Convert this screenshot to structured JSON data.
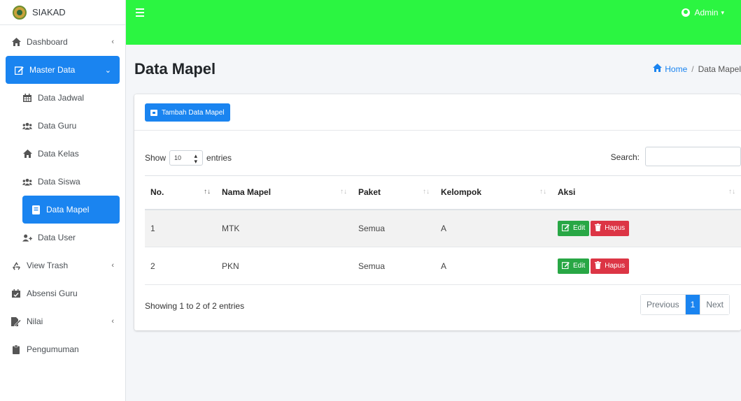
{
  "brand": {
    "name": "SIAKAD"
  },
  "topbar": {
    "user": "Admin"
  },
  "sidebar": {
    "items": [
      {
        "label": "Dashboard",
        "icon": "home-icon"
      },
      {
        "label": "Master Data",
        "icon": "edit-icon"
      },
      {
        "label": "Data Jadwal",
        "icon": "calendar-icon"
      },
      {
        "label": "Data Guru",
        "icon": "users-icon"
      },
      {
        "label": "Data Kelas",
        "icon": "home-icon"
      },
      {
        "label": "Data Siswa",
        "icon": "users-icon"
      },
      {
        "label": "Data Mapel",
        "icon": "book-icon"
      },
      {
        "label": "Data User",
        "icon": "user-plus-icon"
      },
      {
        "label": "View Trash",
        "icon": "recycle-icon"
      },
      {
        "label": "Absensi Guru",
        "icon": "calendar-check-icon"
      },
      {
        "label": "Nilai",
        "icon": "file-signature-icon"
      },
      {
        "label": "Pengumuman",
        "icon": "clipboard-icon"
      }
    ]
  },
  "page": {
    "title": "Data Mapel",
    "breadcrumb": {
      "home": "Home",
      "sep": "/",
      "current": "Data Mapel"
    }
  },
  "card": {
    "add_button": "Tambah Data Mapel",
    "show_label": "Show",
    "entries_value": "10",
    "entries_label": "entries",
    "search_label": "Search:",
    "columns": [
      "No.",
      "Nama Mapel",
      "Paket",
      "Kelompok",
      "Aksi"
    ],
    "rows": [
      {
        "no": "1",
        "nama": "MTK",
        "paket": "Semua",
        "kelompok": "A"
      },
      {
        "no": "2",
        "nama": "PKN",
        "paket": "Semua",
        "kelompok": "A"
      }
    ],
    "edit_label": "Edit",
    "delete_label": "Hapus",
    "info": "Showing 1 to 2 of 2 entries",
    "pager": {
      "prev": "Previous",
      "current": "1",
      "next": "Next"
    }
  },
  "colors": {
    "topbar": "#2bf541",
    "primary": "#1a84f0",
    "success": "#28a745",
    "danger": "#dc3545"
  }
}
